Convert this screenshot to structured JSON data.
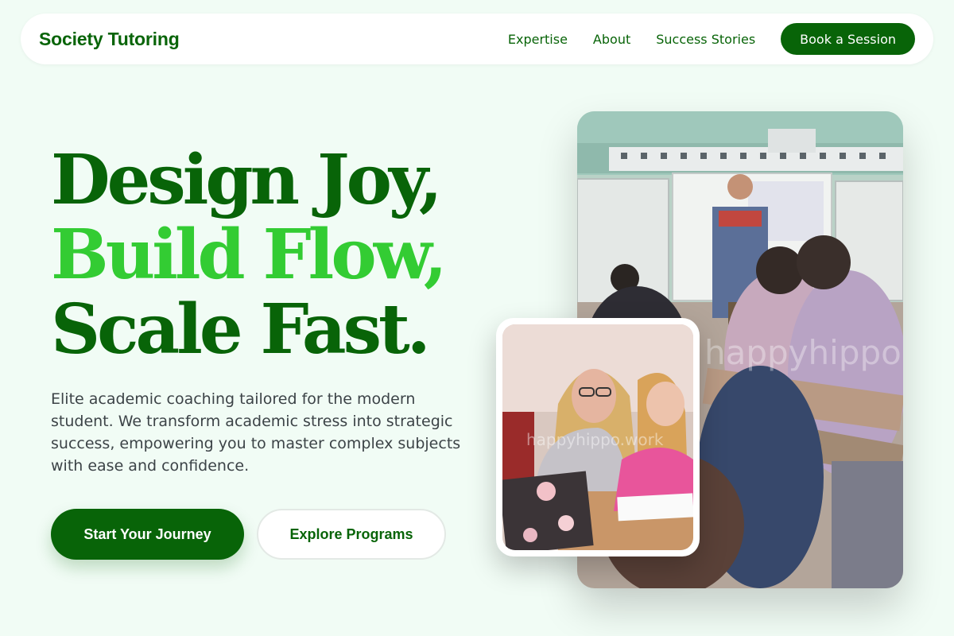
{
  "nav": {
    "brand": "Society Tutoring",
    "links": [
      "Expertise",
      "About",
      "Success Stories"
    ],
    "cta": "Book a Session"
  },
  "hero": {
    "headline": [
      "Design Joy,",
      "Build Flow,",
      "Scale Fast."
    ],
    "description": "Elite academic coaching tailored for the modern student. We transform academic stress into strategic success, empowering you to master complex subjects with ease and confidence.",
    "primary_cta": "Start Your Journey",
    "secondary_cta": "Explore Programs"
  },
  "images": {
    "main_watermark": "happyhippo.work",
    "small_watermark": "happyhippo.work"
  },
  "colors": {
    "primary": "#086408",
    "accent": "#33cc33",
    "background": "#f1fcf5",
    "text": "#3c4347"
  }
}
